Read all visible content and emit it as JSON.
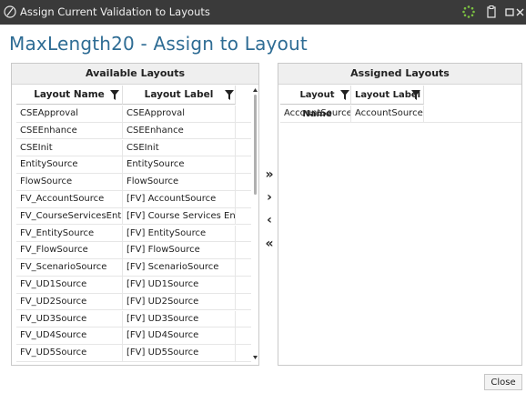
{
  "window": {
    "title": "Assign Current Validation to Layouts"
  },
  "page": {
    "heading": "MaxLength20 - Assign to Layout"
  },
  "available": {
    "header": "Available Layouts",
    "columns": [
      "Layout Name",
      "Layout Label"
    ],
    "rows": [
      {
        "name": "CSEApproval",
        "label": "CSEApproval"
      },
      {
        "name": "CSEEnhance",
        "label": "CSEEnhance"
      },
      {
        "name": "CSEInit",
        "label": "CSEInit"
      },
      {
        "name": "EntitySource",
        "label": "EntitySource"
      },
      {
        "name": "FlowSource",
        "label": "FlowSource"
      },
      {
        "name": "FV_AccountSource",
        "label": "[FV] AccountSource"
      },
      {
        "name": "FV_CourseServicesEntities",
        "label": "[FV] Course Services Entities"
      },
      {
        "name": "FV_EntitySource",
        "label": "[FV] EntitySource"
      },
      {
        "name": "FV_FlowSource",
        "label": "[FV] FlowSource"
      },
      {
        "name": "FV_ScenarioSource",
        "label": "[FV] ScenarioSource"
      },
      {
        "name": "FV_UD1Source",
        "label": "[FV] UD1Source"
      },
      {
        "name": "FV_UD2Source",
        "label": "[FV] UD2Source"
      },
      {
        "name": "FV_UD3Source",
        "label": "[FV] UD3Source"
      },
      {
        "name": "FV_UD4Source",
        "label": "[FV] UD4Source"
      },
      {
        "name": "FV_UD5Source",
        "label": "[FV] UD5Source"
      }
    ]
  },
  "assigned": {
    "header": "Assigned Layouts",
    "columns": [
      "Layout Name",
      "Layout Label"
    ],
    "rows": [
      {
        "name": "AccountSource",
        "label": "AccountSource"
      }
    ]
  },
  "transfer": {
    "add_all": "»",
    "add": "›",
    "remove": "‹",
    "remove_all": "«"
  },
  "footer": {
    "close_label": "Close"
  },
  "icons": {
    "app": "validation-icon",
    "busy": "spinner-icon",
    "clipboard": "clipboard-icon",
    "maximize": "maximize-icon",
    "close": "close-icon",
    "filter": "filter-icon"
  },
  "colors": {
    "titlebar": "#3a3a3a",
    "heading": "#2e6c94",
    "spinner": "#7cc242"
  }
}
